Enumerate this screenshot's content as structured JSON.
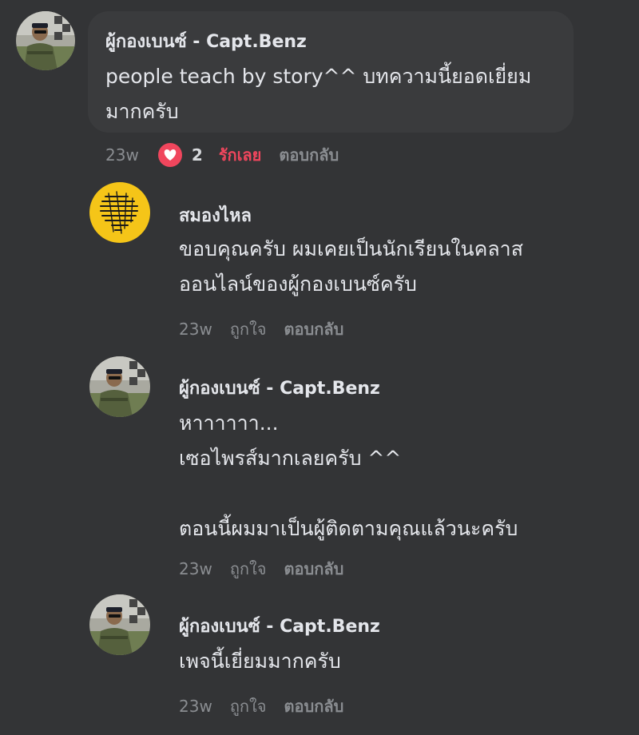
{
  "thread": {
    "root": {
      "author": "ผู้กองเบนซ์ - Capt.Benz",
      "text": "people teach by story^^ บทความนี้ยอดเยี่ยม\nมากครับ",
      "time": "23w",
      "reaction_count": "2",
      "reaction_label": "รักเลย",
      "reply_label": "ตอบกลับ",
      "reaction_icon": "heart-icon",
      "reaction_color": "#f0465d"
    },
    "replies": [
      {
        "author": "สมองไหล",
        "text": "ขอบคุณครับ ผมเคยเป็นนักเรียนในคลาส\nออนไลน์ของผู้กองเบนซ์ครับ",
        "time": "23w",
        "like_label": "ถูกใจ",
        "reply_label": "ตอบกลับ"
      },
      {
        "author": "ผู้กองเบนซ์ - Capt.Benz",
        "text": "หาาาาาา...\nเซอไพรส์มากเลยครับ ^^\n\nตอนนี้ผมมาเป็นผู้ติดตามคุณแล้วนะครับ",
        "time": "23w",
        "like_label": "ถูกใจ",
        "reply_label": "ตอบกลับ"
      },
      {
        "author": "ผู้กองเบนซ์ - Capt.Benz",
        "text": "เพจนี้เยี่ยมมากครับ",
        "time": "23w",
        "like_label": "ถูกใจ",
        "reply_label": "ตอบกลับ"
      }
    ]
  },
  "colors": {
    "background": "#333436",
    "bubble": "#3a3b3d",
    "text": "#e4e6eb",
    "muted": "#8a8d91",
    "love": "#f0465d",
    "brain_avatar": "#f5c518"
  }
}
